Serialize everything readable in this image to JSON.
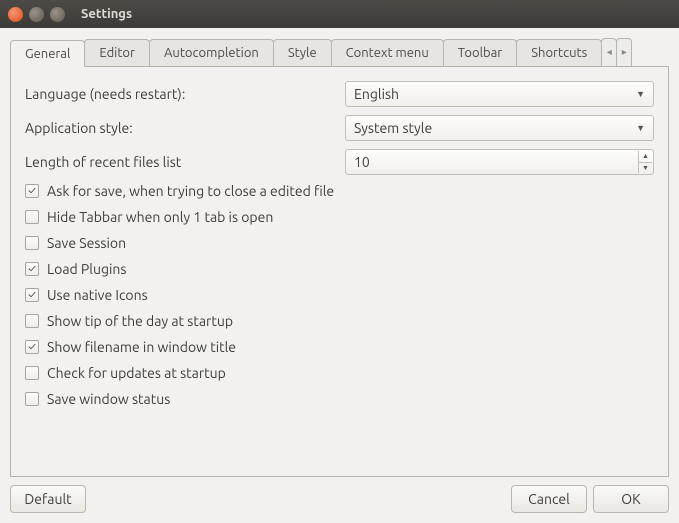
{
  "window": {
    "title": "Settings"
  },
  "tabs": [
    {
      "label": "General"
    },
    {
      "label": "Editor"
    },
    {
      "label": "Autocompletion"
    },
    {
      "label": "Style"
    },
    {
      "label": "Context menu"
    },
    {
      "label": "Toolbar"
    },
    {
      "label": "Shortcuts"
    }
  ],
  "fields": {
    "language_label": "Language (needs restart):",
    "language_value": "English",
    "appstyle_label": "Application style:",
    "appstyle_value": "System style",
    "recent_label": "Length of recent files list",
    "recent_value": "10"
  },
  "checks": [
    {
      "label": "Ask for save, when trying to close a edited file",
      "checked": true
    },
    {
      "label": "Hide Tabbar when only 1 tab is open",
      "checked": false
    },
    {
      "label": "Save Session",
      "checked": false
    },
    {
      "label": "Load Plugins",
      "checked": true
    },
    {
      "label": "Use native Icons",
      "checked": true
    },
    {
      "label": "Show tip of the day at startup",
      "checked": false
    },
    {
      "label": "Show filename in window title",
      "checked": true
    },
    {
      "label": "Check for updates at startup",
      "checked": false
    },
    {
      "label": "Save window status",
      "checked": false
    }
  ],
  "buttons": {
    "default": "Default",
    "cancel": "Cancel",
    "ok": "OK"
  }
}
